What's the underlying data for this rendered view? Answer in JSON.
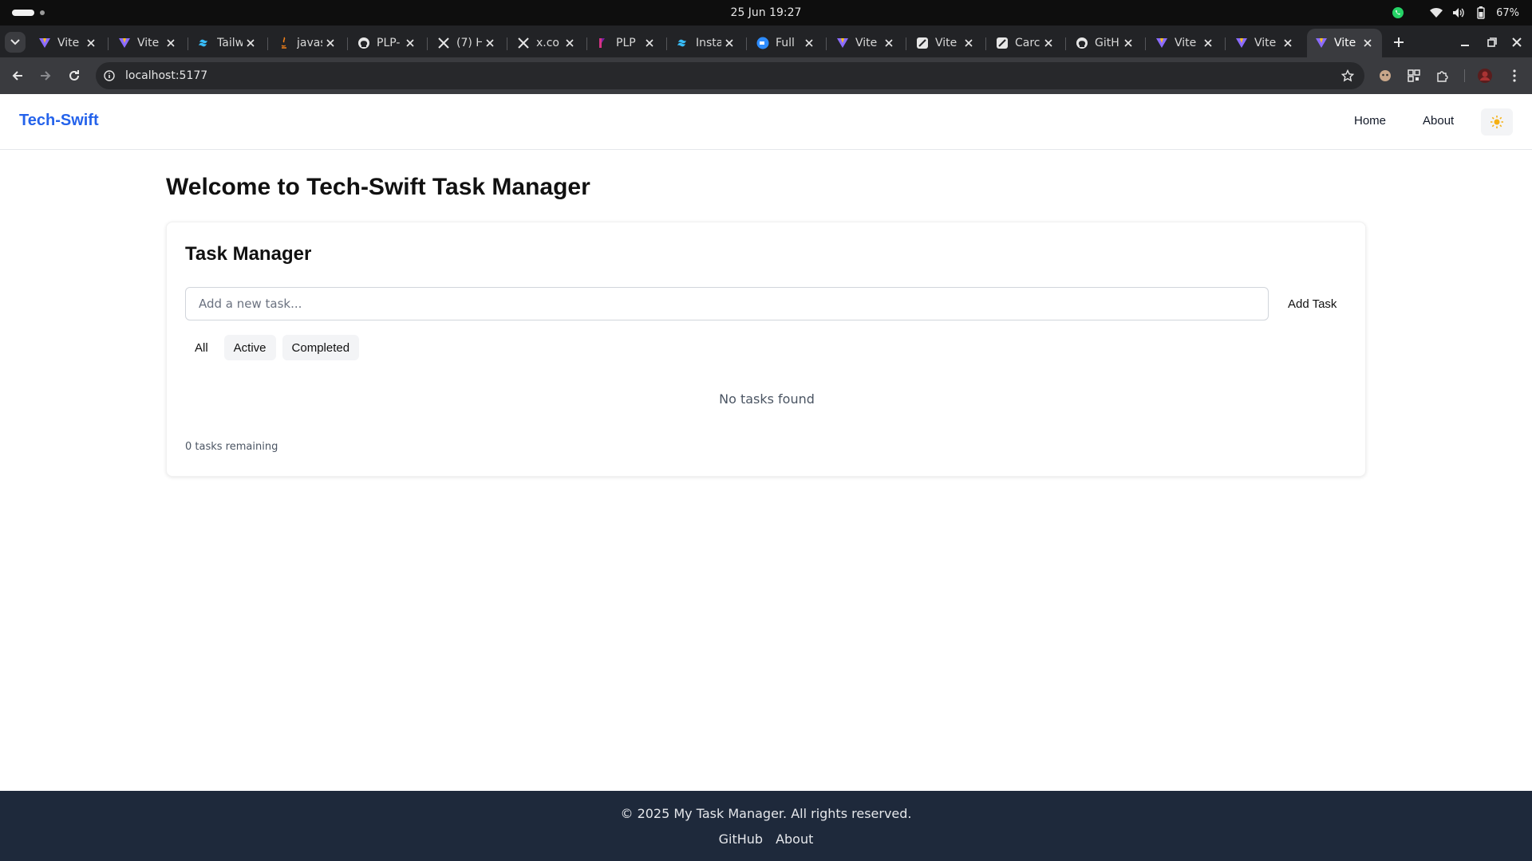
{
  "os": {
    "clock": "25 Jun  19:27",
    "battery": "67%"
  },
  "browser": {
    "tabs": [
      {
        "title": "Vite",
        "icon": "vite-icon",
        "active": false
      },
      {
        "title": "Vite",
        "icon": "vite-icon",
        "active": false
      },
      {
        "title": "Tailw",
        "icon": "tailwind-icon",
        "active": false
      },
      {
        "title": "javas",
        "icon": "java-icon",
        "active": false
      },
      {
        "title": "PLP-",
        "icon": "github-icon",
        "active": false
      },
      {
        "title": "(7) H",
        "icon": "x-icon",
        "active": false
      },
      {
        "title": "x.co",
        "icon": "x-icon",
        "active": false
      },
      {
        "title": "PLP",
        "icon": "plp-icon",
        "active": false
      },
      {
        "title": "Insta",
        "icon": "tailwind-icon",
        "active": false
      },
      {
        "title": "Full",
        "icon": "zoom-icon",
        "active": false
      },
      {
        "title": "Vite",
        "icon": "vite-icon",
        "active": false
      },
      {
        "title": "Vite",
        "icon": "slash-icon",
        "active": false
      },
      {
        "title": "Carc",
        "icon": "slash-icon",
        "active": false
      },
      {
        "title": "GitH",
        "icon": "github-icon",
        "active": false
      },
      {
        "title": "Vite",
        "icon": "vite-icon",
        "active": false
      },
      {
        "title": "Vite",
        "icon": "vite-icon",
        "active": false
      },
      {
        "title": "Vite",
        "icon": "vite-icon",
        "active": true
      }
    ],
    "url": "localhost:5177"
  },
  "site": {
    "brand": "Tech-Swift",
    "nav": {
      "home": "Home",
      "about": "About"
    },
    "theme_icon": "sun-icon",
    "brand_color": "#2563eb",
    "footer_color": "#1e293b"
  },
  "main": {
    "title": "Welcome to Tech-Swift Task Manager",
    "card": {
      "title": "Task Manager",
      "input_placeholder": "Add a new task...",
      "input_value": "",
      "add_button": "Add Task",
      "filters": [
        "All",
        "Active",
        "Completed"
      ],
      "selected_filter": "All",
      "empty_message": "No tasks found",
      "remaining": "0 tasks remaining"
    }
  },
  "footer": {
    "copyright": "© 2025 My Task Manager. All rights reserved.",
    "links": [
      "GitHub",
      "About"
    ]
  }
}
